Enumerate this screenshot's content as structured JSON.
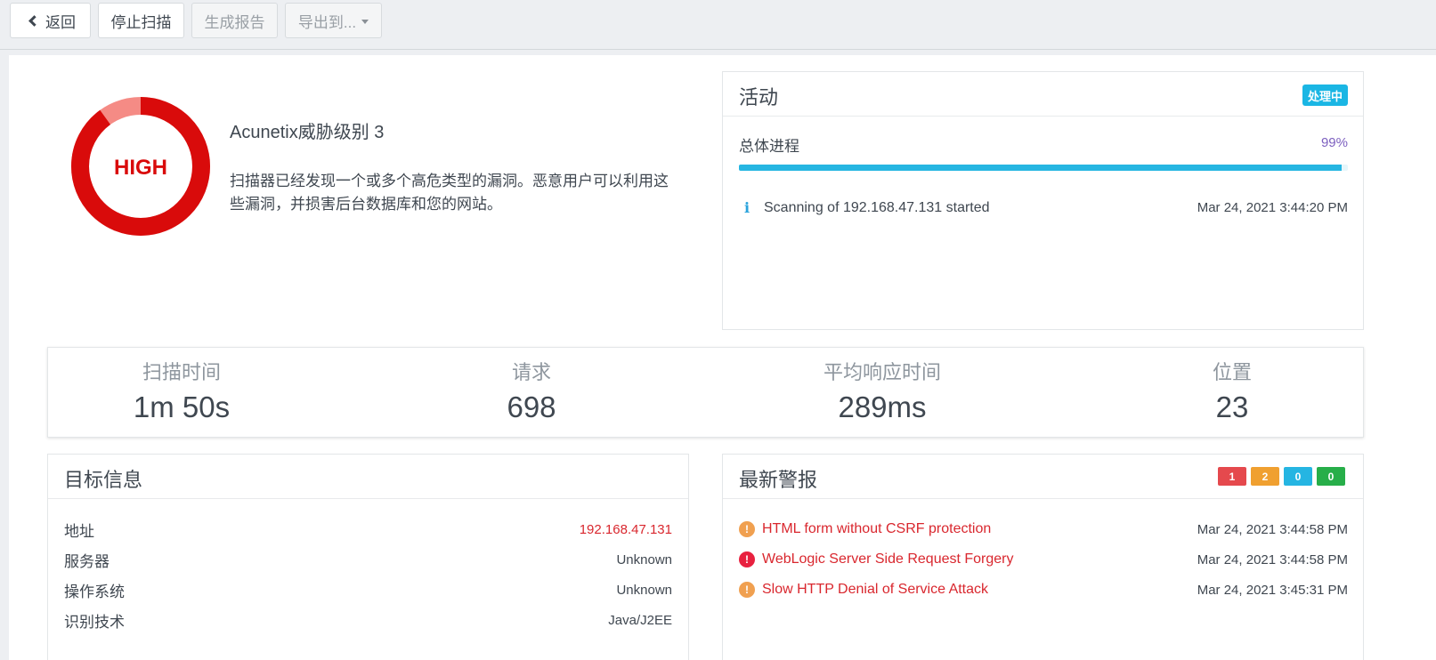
{
  "toolbar": {
    "back_label": "返回",
    "stop_label": "停止扫描",
    "report_label": "生成报告",
    "export_label": "导出到..."
  },
  "threat": {
    "donut_label": "HIGH",
    "donut_fill_fraction": 0.9,
    "colors": {
      "main": "#d90b0b",
      "secondary": "#f58b85"
    },
    "title": "Acunetix威胁级别 3",
    "description": "扫描器已经发现一个或多个高危类型的漏洞。恶意用户可以利用这些漏洞，并损害后台数据库和您的网站。"
  },
  "activity": {
    "title": "活动",
    "status_badge": "处理中",
    "progress_label": "总体进程",
    "progress_value": "99%",
    "progress_fraction": 0.99,
    "entries": [
      {
        "icon": "info-icon",
        "text": "Scanning of 192.168.47.131 started",
        "time": "Mar 24, 2021 3:44:20 PM"
      }
    ]
  },
  "stats": [
    {
      "label": "扫描时间",
      "value": "1m 50s"
    },
    {
      "label": "请求",
      "value": "698"
    },
    {
      "label": "平均响应时间",
      "value": "289ms"
    },
    {
      "label": "位置",
      "value": "23"
    }
  ],
  "target": {
    "title": "目标信息",
    "rows": [
      {
        "key": "地址",
        "value": "192.168.47.131"
      },
      {
        "key": "服务器",
        "value": "Unknown"
      },
      {
        "key": "操作系统",
        "value": "Unknown"
      },
      {
        "key": "识别技术",
        "value": "Java/J2EE"
      }
    ]
  },
  "alerts": {
    "title": "最新警报",
    "counts": [
      {
        "value": "1",
        "color": "#e5494d"
      },
      {
        "value": "2",
        "color": "#f0a030"
      },
      {
        "value": "0",
        "color": "#25b5e2"
      },
      {
        "value": "0",
        "color": "#27ae49"
      }
    ],
    "items": [
      {
        "severity": "medium",
        "icon": "exclamation-icon",
        "color": "#f0a050",
        "name": "HTML form without CSRF protection",
        "time": "Mar 24, 2021 3:44:58 PM"
      },
      {
        "severity": "high",
        "icon": "exclamation-icon",
        "color": "#e8213f",
        "name": "WebLogic Server Side Request Forgery",
        "time": "Mar 24, 2021 3:44:58 PM"
      },
      {
        "severity": "medium",
        "icon": "exclamation-icon",
        "color": "#f0a050",
        "name": "Slow HTTP Denial of Service Attack",
        "time": "Mar 24, 2021 3:45:31 PM"
      }
    ]
  }
}
